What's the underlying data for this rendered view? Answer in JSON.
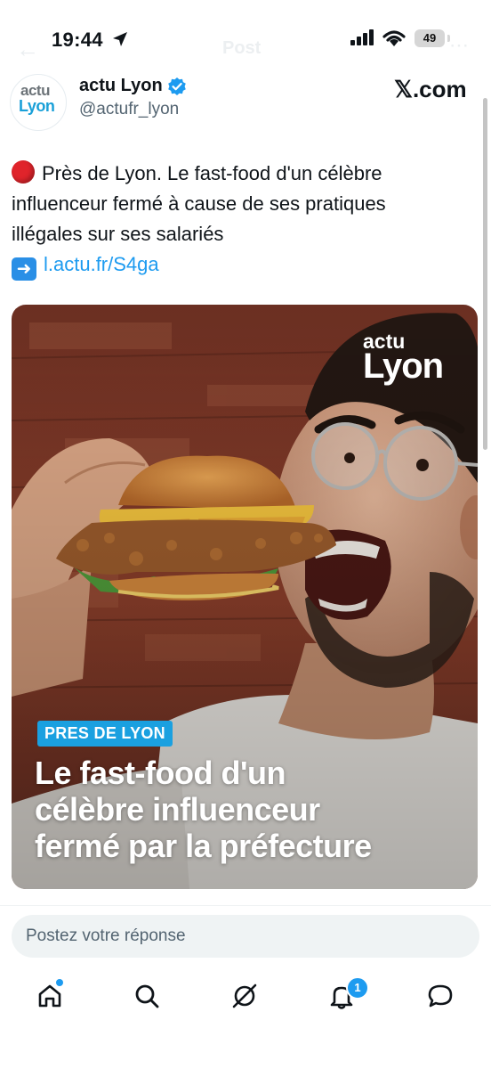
{
  "status_bar": {
    "time": "19:44",
    "battery": "49"
  },
  "header_ghost": {
    "title": "Post"
  },
  "tweet": {
    "display_name": "actu Lyon",
    "handle": "@actufr_lyon",
    "avatar_line1": "actu",
    "avatar_line2": "Lyon",
    "source": "𝕏.com",
    "text_line1": "Près de Lyon. Le fast-food d'un célèbre",
    "text_line2": "influenceur fermé à cause de ses pratiques",
    "text_line3": "illégales sur ses salariés",
    "link": "l.actu.fr/S4ga"
  },
  "media": {
    "brand_line1": "actu",
    "brand_line2": "Lyon",
    "tag": "PRES DE LYON",
    "headline_line1": "Le fast-food d'un",
    "headline_line2": "célèbre influenceur",
    "headline_line3": "fermé par la préfecture"
  },
  "reply": {
    "placeholder": "Postez votre réponse"
  },
  "nav": {
    "notifications_count": "1"
  },
  "colors": {
    "accent": "#1d9bf0",
    "badge": "#1aa0e0",
    "red": "#e0242b"
  }
}
